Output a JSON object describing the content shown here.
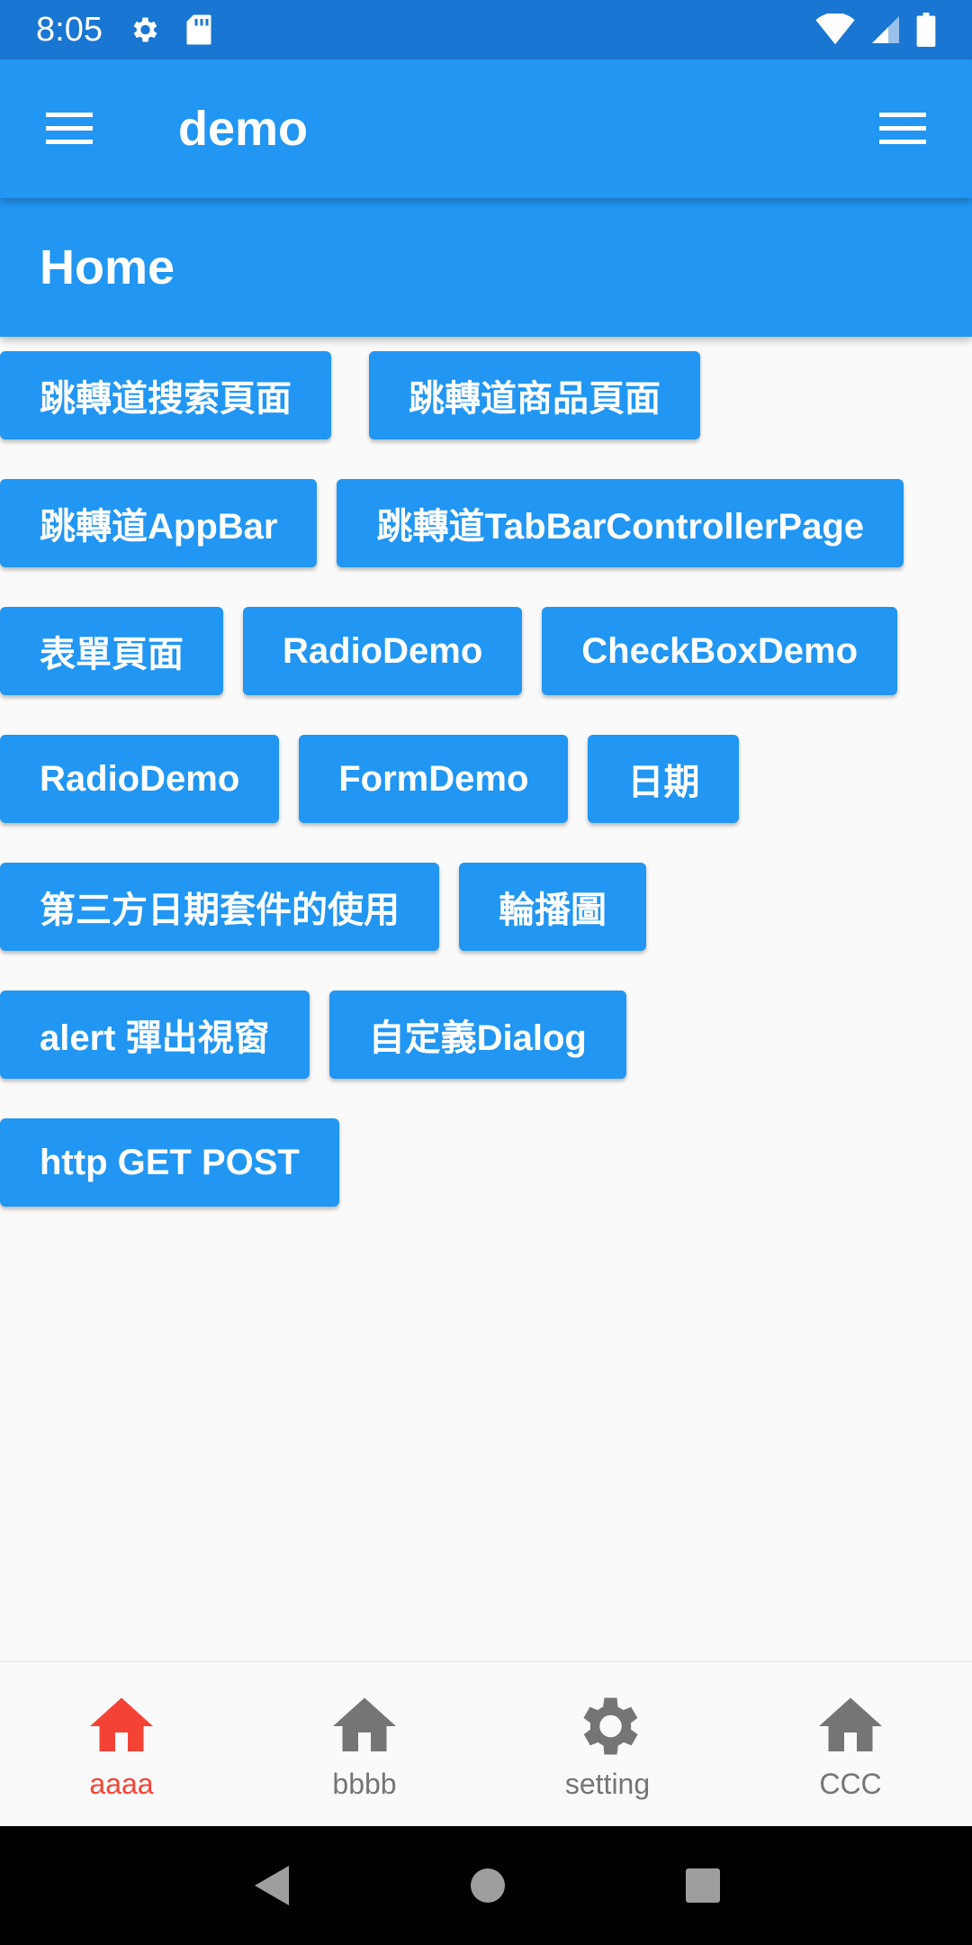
{
  "status_bar": {
    "time": "8:05"
  },
  "app_bar": {
    "title": "demo"
  },
  "page_header": {
    "title": "Home"
  },
  "buttons": [
    [
      "跳轉道搜索頁面",
      "跳轉道商品頁面"
    ],
    [
      "跳轉道AppBar",
      "跳轉道TabBarControllerPage"
    ],
    [
      "表單頁面",
      "RadioDemo",
      "CheckBoxDemo"
    ],
    [
      "RadioDemo",
      "FormDemo",
      "日期"
    ],
    [
      "第三方日期套件的使用",
      "輪播圖"
    ],
    [
      "alert 彈出視窗",
      "自定義Dialog"
    ],
    [
      "http GET POST"
    ]
  ],
  "bottom_nav": [
    {
      "label": "aaaa",
      "icon": "home-icon",
      "active": true
    },
    {
      "label": "bbbb",
      "icon": "home-icon",
      "active": false
    },
    {
      "label": "setting",
      "icon": "gear-icon",
      "active": false
    },
    {
      "label": "CCC",
      "icon": "home-icon",
      "active": false
    }
  ],
  "colors": {
    "primary": "#2196f3",
    "status_bar": "#1976d2",
    "active_tab": "#f44336",
    "inactive_tab": "#757575"
  }
}
